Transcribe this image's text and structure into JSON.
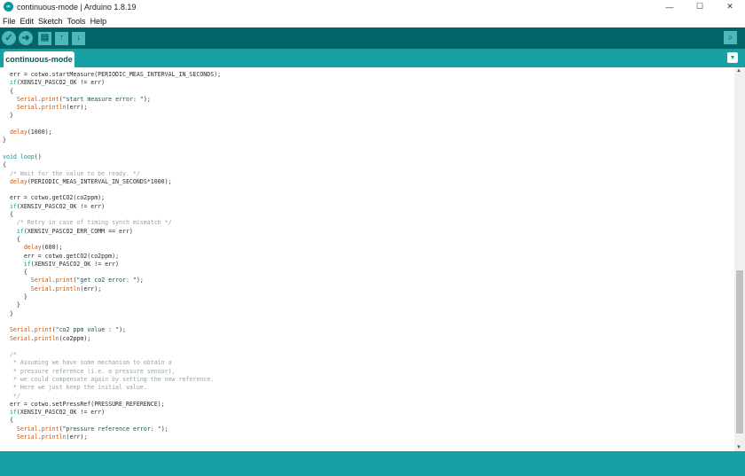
{
  "window": {
    "title": "continuous-mode | Arduino 1.8.19",
    "logo_text": "∞",
    "minimize": "—",
    "maximize": "☐",
    "close": "✕"
  },
  "menu": {
    "items": [
      {
        "label": "File"
      },
      {
        "label": "Edit"
      },
      {
        "label": "Sketch"
      },
      {
        "label": "Tools"
      },
      {
        "label": "Help"
      }
    ]
  },
  "toolbar": {
    "verify_icon": "✓",
    "upload_icon": "➜",
    "new_icon": "▤",
    "open_icon": "↑",
    "save_icon": "↓",
    "serial_icon": "⌕"
  },
  "tabs": {
    "active": "continuous-mode",
    "menu_icon": "▼"
  },
  "editor": {
    "lines": [
      "  err = cotwo.startMeasure(PERIODIC_MEAS_INTERVAL_IN_SECONDS);",
      "  if(XENSIV_PASCO2_OK != err)",
      "  {",
      "    Serial.print(\"start measure error: \");",
      "    Serial.println(err);",
      "  }",
      "",
      "  delay(1000);",
      "}",
      "",
      "void loop()",
      "{",
      "  /* Wait for the value to be ready. */",
      "  delay(PERIODIC_MEAS_INTERVAL_IN_SECONDS*1000);",
      "",
      "  err = cotwo.getCO2(co2ppm);",
      "  if(XENSIV_PASCO2_OK != err)",
      "  {",
      "    /* Retry in case of timing synch mismatch */",
      "    if(XENSIV_PASCO2_ERR_COMM == err)",
      "    {",
      "      delay(600);",
      "      err = cotwo.getCO2(co2ppm);",
      "      if(XENSIV_PASCO2_OK != err)",
      "      {",
      "        Serial.print(\"get co2 error: \");",
      "        Serial.println(err);",
      "      }",
      "    }",
      "  }",
      "",
      "  Serial.print(\"co2 ppm value : \");",
      "  Serial.println(co2ppm);",
      "",
      "  /*",
      "   * Assuming we have some mechanism to obtain a",
      "   * pressure reference (i.e. a pressure sensor),",
      "   * we could compensate again by setting the new reference.",
      "   * Here we just keep the initial value.",
      "   */",
      "  err = cotwo.setPressRef(PRESSURE_REFERENCE);",
      "  if(XENSIV_PASCO2_OK != err)",
      "  {",
      "    Serial.print(\"pressure reference error: \");",
      "    Serial.println(err);"
    ]
  },
  "colors": {
    "toolbar_bg": "#006468",
    "tabbar_bg": "#17a1a5",
    "keyword": "#00979c",
    "function": "#d35400",
    "comment": "#95a5a6",
    "string": "#005c5f"
  },
  "scrollbar": {
    "up_icon": "▲",
    "down_icon": "▼",
    "position": 0.55,
    "visible_fraction": 0.45
  }
}
